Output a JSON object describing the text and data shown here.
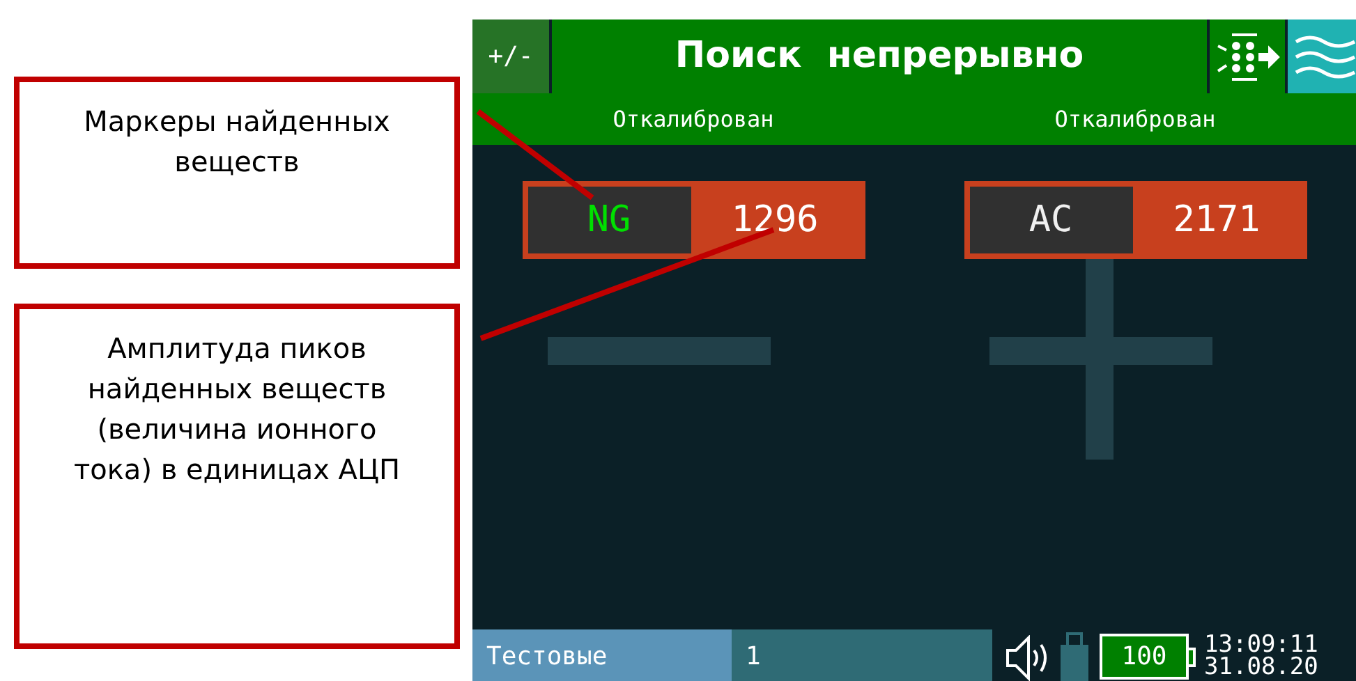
{
  "callouts": [
    {
      "text": "Маркеры найденных веществ"
    },
    {
      "text": "Амплитуда пиков найденных веществ (величина ионного тока) в единицах АЦП"
    }
  ],
  "screen": {
    "sign_button": "+/-",
    "title": "Поиск  непрерывно",
    "calibration": [
      "Откалиброван",
      "Откалиброван"
    ],
    "channels": [
      {
        "marker": "NG",
        "color": "#00e000",
        "amplitude": "1296",
        "kind": "minus"
      },
      {
        "marker": "AC",
        "color": "#f0f0f0",
        "amplitude": "2171",
        "kind": "plus"
      }
    ],
    "status_bar": {
      "library": "Тестовые",
      "number": "1",
      "battery": "100",
      "time": "13:09:11",
      "date": "31.08.20"
    }
  }
}
